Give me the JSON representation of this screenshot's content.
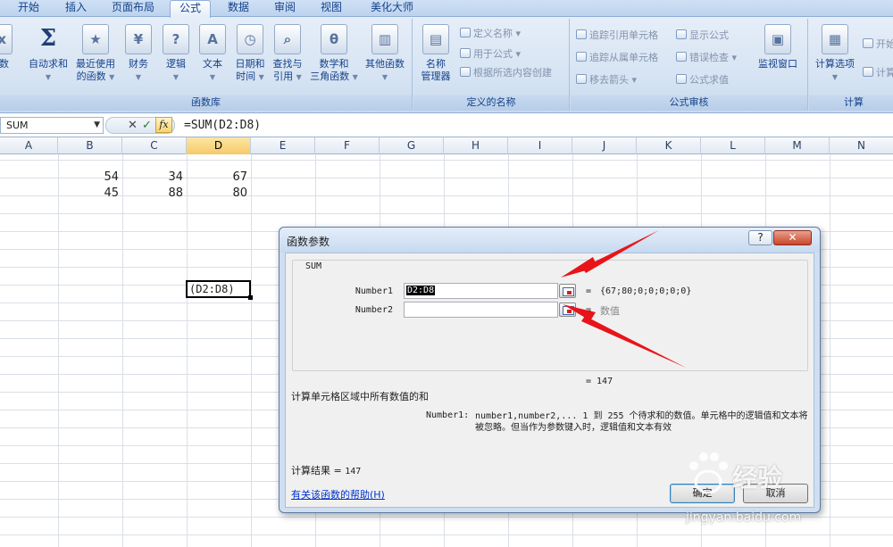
{
  "ribbon": {
    "tabs": [
      "开始",
      "插入",
      "页面布局",
      "公式",
      "数据",
      "审阅",
      "视图",
      "美化大师"
    ],
    "active_tab": "公式",
    "function_library": {
      "partial_left": "函数",
      "autosum": "自动求和",
      "recent": [
        "最近使用",
        "的函数"
      ],
      "financial": "财务",
      "logical": "逻辑",
      "text": "文本",
      "datetime": [
        "日期和",
        "时间"
      ],
      "lookup": [
        "查找与",
        "引用"
      ],
      "math": [
        "数学和",
        "三角函数"
      ],
      "other": "其他函数",
      "title": "函数库"
    },
    "defined_names": {
      "name_manager": [
        "名称",
        "管理器"
      ],
      "define_name": "定义名称",
      "use_in_formula": "用于公式",
      "create_from_selection": "根据所选内容创建",
      "title": "定义的名称"
    },
    "formula_auditing": {
      "trace_precedents": "追踪引用单元格",
      "trace_dependents": "追踪从属单元格",
      "remove_arrows": "移去箭头",
      "show_formulas": "显示公式",
      "error_checking": "错误检查",
      "evaluate_formula": "公式求值",
      "watch_window": "监视窗口",
      "title": "公式审核"
    },
    "calculation": {
      "options": "计算选项",
      "calc_now": "开始",
      "calc_sheet": "计算",
      "title": "计算"
    }
  },
  "formula_bar": {
    "name_box": "SUM",
    "cancel": "✕",
    "enter": "✓",
    "fx": "fx",
    "formula": "=SUM(D2:D8)"
  },
  "columns": [
    "A",
    "B",
    "C",
    "D",
    "E",
    "F",
    "G",
    "H",
    "I",
    "J",
    "K",
    "L",
    "M",
    "N"
  ],
  "cells": {
    "b2": "54",
    "c2": "34",
    "d2": "67",
    "b3": "45",
    "c3": "88",
    "d3": "80",
    "edit": "(D2:D8)"
  },
  "dialog": {
    "title": "函数参数",
    "help_button": "?",
    "close_button": "✕",
    "function_name": "SUM",
    "arg1_label": "Number1",
    "arg1_value": "D2:D8",
    "arg1_result": "{67;80;0;0;0;0;0}",
    "arg2_label": "Number2",
    "arg2_result": "数值",
    "equals": "=",
    "total": "= 147",
    "description": "计算单元格区域中所有数值的和",
    "param_name": "Number1:",
    "param_desc": "number1,number2,... 1 到 255 个待求和的数值。单元格中的逻辑值和文本将被忽略。但当作为参数键入时，逻辑值和文本有效",
    "result_label": "计算结果 = ",
    "result_value": "147",
    "help_link": "有关该函数的帮助(H)",
    "ok": "确定",
    "cancel": "取消"
  },
  "watermark": {
    "brand": "经验",
    "url": "jingyan.baidu.com"
  },
  "colors": {
    "accent": "#15428b",
    "arrow": "#e8141a",
    "selected_header": "#f7c967"
  }
}
